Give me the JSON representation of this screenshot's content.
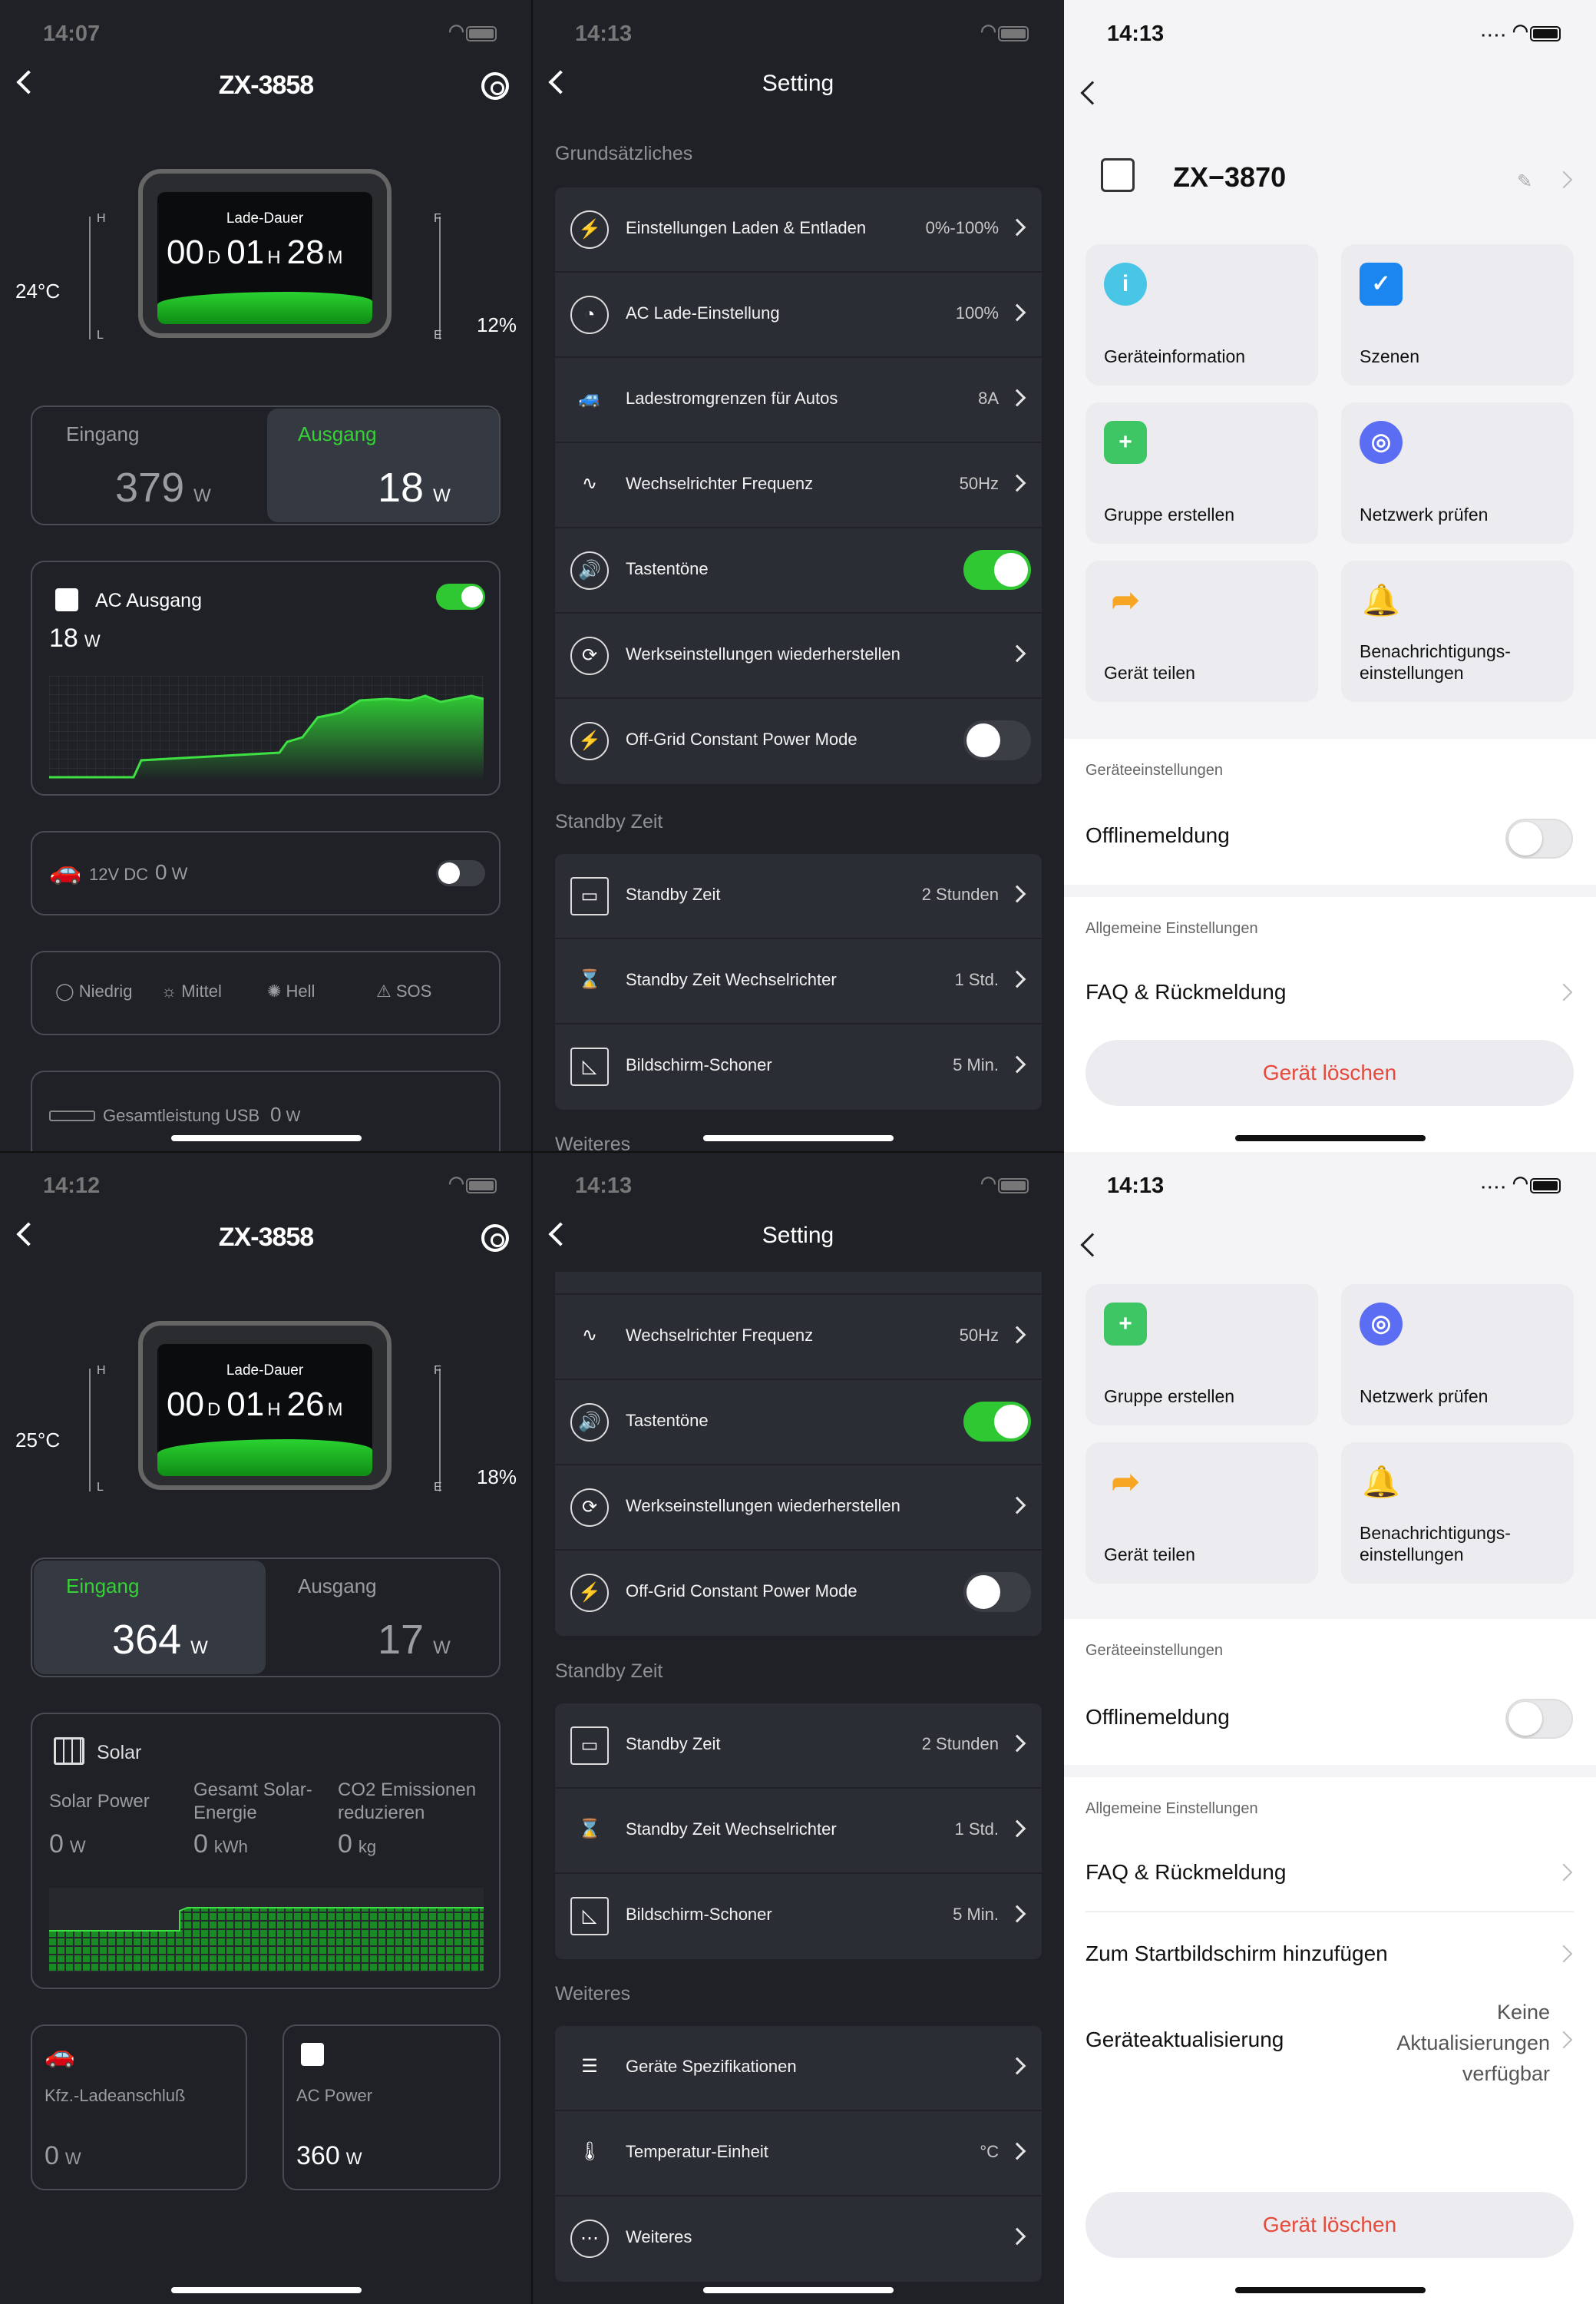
{
  "p1": {
    "time": "14:07",
    "title": "ZX-3858",
    "lade_label": "Lade-Dauer",
    "dd": "00",
    "d": "D",
    "hh": "01",
    "h": "H",
    "mm": "28",
    "m": "M",
    "temp": "24°C",
    "pct": "12%",
    "H": "H",
    "L": "L",
    "F": "F",
    "E": "E",
    "eingang": "Eingang",
    "ausgang": "Ausgang",
    "in_val": "379",
    "out_val": "18",
    "unit_w": "W",
    "ac_label": "AC Ausgang",
    "ac_val": "18",
    "dc_label": "12V DC",
    "dc_val": "0",
    "dc_unit": "W",
    "light": [
      "Niedrig",
      "Mittel",
      "Hell",
      "SOS"
    ],
    "usb_label": "Gesamtleistung USB",
    "usb_val": "0",
    "usb_unit": "W"
  },
  "p2": {
    "time": "14:13",
    "title": "Setting",
    "sec1": "Grundsätzliches",
    "sec2": "Standby Zeit",
    "sec3": "Weiteres",
    "rows1": [
      {
        "label": "Einstellungen Laden & Entladen",
        "value": "0%-100%"
      },
      {
        "label": "AC Lade-Einstellung",
        "value": "100%"
      },
      {
        "label": "Ladestromgrenzen für Autos",
        "value": "8A"
      },
      {
        "label": "Wechselrichter Frequenz",
        "value": "50Hz"
      },
      {
        "label": "Tastentöne",
        "value": ""
      },
      {
        "label": "Werkseinstellungen wiederherstellen",
        "value": ""
      },
      {
        "label": "Off-Grid Constant Power Mode",
        "value": ""
      }
    ],
    "rows2": [
      {
        "label": "Standby Zeit",
        "value": "2 Stunden"
      },
      {
        "label": "Standby Zeit Wechselrichter",
        "value": "1 Std."
      },
      {
        "label": "Bildschirm-Schoner",
        "value": "5 Min."
      }
    ]
  },
  "p3": {
    "time": "14:13",
    "device": "ZX−3870",
    "tiles": [
      "Geräteinformation",
      "Szenen",
      "Gruppe erstellen",
      "Netzwerk prüfen",
      "Gerät teilen",
      "Benachrichtigungs-\neinstellungen"
    ],
    "sec1": "Geräteeinstellungen",
    "offline": "Offlinemeldung",
    "sec2": "Allgemeine Einstellungen",
    "faq": "FAQ & Rückmeldung",
    "delete": "Gerät löschen"
  },
  "p4": {
    "time": "14:12",
    "title": "ZX-3858",
    "lade_label": "Lade-Dauer",
    "dd": "00",
    "d": "D",
    "hh": "01",
    "h": "H",
    "mm": "26",
    "m": "M",
    "temp": "25°C",
    "pct": "18%",
    "H": "H",
    "L": "L",
    "F": "F",
    "E": "E",
    "eingang": "Eingang",
    "ausgang": "Ausgang",
    "in_val": "364",
    "out_val": "17",
    "unit_w": "W",
    "solar": "Solar",
    "solar_power": "Solar Power",
    "gesamt": "Gesamt Solar-\nEnergie",
    "co2": "CO2 Emissionen\nreduzieren",
    "sp_val": "0",
    "sp_unit": "W",
    "ge_val": "0",
    "ge_unit": "kWh",
    "co_val": "0",
    "co_unit": "kg",
    "kfz": "Kfz.-Ladeanschluß",
    "kfz_val": "0",
    "kfz_unit": "W",
    "acp": "AC Power",
    "acp_val": "360",
    "acp_unit": "W"
  },
  "p5": {
    "time": "14:13",
    "title": "Setting",
    "sec2": "Standby Zeit",
    "sec3": "Weiteres",
    "rows1": [
      {
        "label": "Wechselrichter Frequenz",
        "value": "50Hz"
      },
      {
        "label": "Tastentöne",
        "value": ""
      },
      {
        "label": "Werkseinstellungen wiederherstellen",
        "value": ""
      },
      {
        "label": "Off-Grid Constant Power Mode",
        "value": ""
      }
    ],
    "rows2": [
      {
        "label": "Standby Zeit",
        "value": "2 Stunden"
      },
      {
        "label": "Standby Zeit Wechselrichter",
        "value": "1 Std."
      },
      {
        "label": "Bildschirm-Schoner",
        "value": "5 Min."
      }
    ],
    "rows3": [
      {
        "label": "Geräte Spezifikationen",
        "value": ""
      },
      {
        "label": "Temperatur-Einheit",
        "value": "°C"
      },
      {
        "label": "Weiteres",
        "value": ""
      }
    ]
  },
  "p6": {
    "time": "14:13",
    "tiles": [
      "Gruppe erstellen",
      "Netzwerk prüfen",
      "Gerät teilen",
      "Benachrichtigungs-\neinstellungen"
    ],
    "sec1": "Geräteeinstellungen",
    "offline": "Offlinemeldung",
    "sec2": "Allgemeine Einstellungen",
    "faq": "FAQ & Rückmeldung",
    "home": "Zum Startbildschirm hinzufügen",
    "upd": "Geräteaktualisierung",
    "upd_val": "Keine\nAktualisierungen\nverfügbar",
    "delete": "Gerät löschen"
  }
}
